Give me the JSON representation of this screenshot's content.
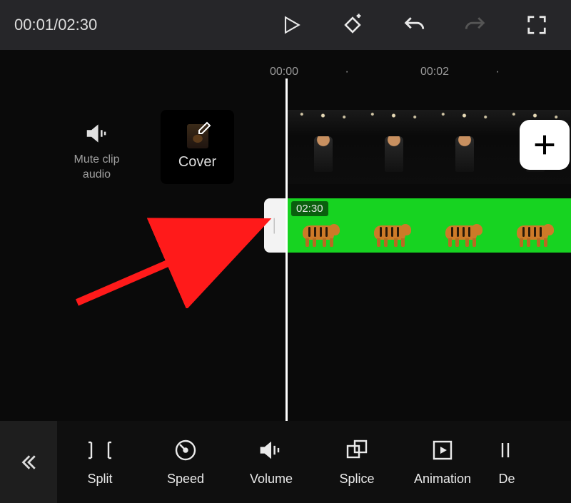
{
  "topbar": {
    "current_time": "00:01",
    "total_time": "02:30",
    "separator": "/"
  },
  "ruler": {
    "marks": [
      "00:00",
      "·",
      "00:02",
      "·"
    ]
  },
  "left_panel": {
    "mute_label_line1": "Mute clip",
    "mute_label_line2": "audio",
    "cover_label": "Cover"
  },
  "overlay_track": {
    "duration": "02:30"
  },
  "toolbar": {
    "items": [
      "Split",
      "Speed",
      "Volume",
      "Splice",
      "Animation",
      "De"
    ]
  },
  "colors": {
    "green_screen": "#17d321",
    "annotation_red": "#ff1a1a"
  }
}
